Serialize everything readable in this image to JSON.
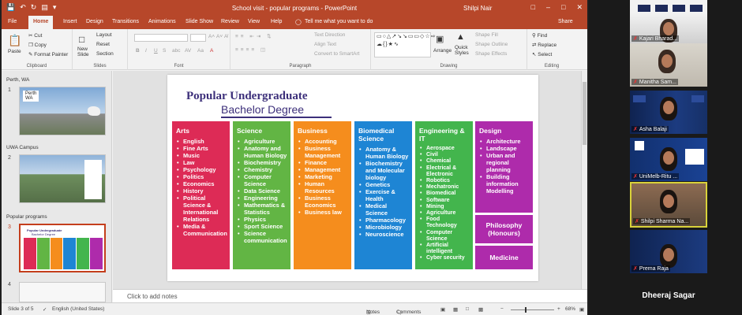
{
  "window": {
    "title": "School visit - popular programs  -  PowerPoint",
    "user": "Shilpi Nair",
    "qat_icons": [
      "save-icon",
      "undo-icon",
      "redo-icon",
      "present-icon"
    ],
    "controls": [
      "–",
      "□",
      "✕"
    ],
    "accent": "#b7472a"
  },
  "tabs": [
    "File",
    "Home",
    "Insert",
    "Design",
    "Transitions",
    "Animations",
    "Slide Show",
    "Review",
    "View",
    "Help"
  ],
  "tell_me": "Tell me what you want to do",
  "share": "Share",
  "ribbon": {
    "clipboard": {
      "paste": "Paste",
      "cut": "Cut",
      "copy": "Copy",
      "format_painter": "Format Painter",
      "label": "Clipboard"
    },
    "slides": {
      "new_slide": "New\nSlide",
      "layout": "Layout",
      "reset": "Reset",
      "section": "Section",
      "label": "Slides"
    },
    "font": {
      "label": "Font",
      "size_up": "A˄",
      "size_down": "A˅",
      "clear": "A̸",
      "bold": "B",
      "italic": "I",
      "underline": "U",
      "strike": "S",
      "abc": "abc",
      "spacing": "AV",
      "case": "Aa",
      "highlight": "A"
    },
    "paragraph": {
      "text_direction": "Text Direction",
      "align_text": "Align Text",
      "smartart": "Convert to SmartArt",
      "label": "Paragraph"
    },
    "drawing": {
      "shapes": "▭○△↗↘↘▭▭◇☆⇨☁{}★∿",
      "arrange": "Arrange",
      "quick_styles": "Quick\nStyles",
      "fill": "Shape Fill",
      "outline": "Shape Outline",
      "effects": "Shape Effects",
      "label": "Drawing"
    },
    "editing": {
      "find": "Find",
      "replace": "Replace",
      "select": "Select",
      "label": "Editing"
    }
  },
  "thumbnails": {
    "sections": [
      {
        "name": "Perth, WA",
        "slide_num": "1",
        "label": "Perth\nWA"
      },
      {
        "name": "UWA Campus",
        "slide_num": "2"
      },
      {
        "name": "Popular programs",
        "slide_num": "3",
        "t1": "Popular Undergraduate",
        "t2": "Bachelor Degree"
      },
      {
        "name": "",
        "slide_num": "4"
      }
    ]
  },
  "slide": {
    "title_line1": "Popular Undergraduate",
    "title_line2": "Bachelor Degree",
    "title_color": "#3c2f7a",
    "columns": [
      {
        "id": "arts",
        "heading": "Arts",
        "color": "#dd2b56",
        "items": [
          "English",
          "Fine Arts",
          "Music",
          "Law",
          "Psychology",
          "Politics",
          "Economics",
          "History",
          "Political Science & International Relations",
          "Media & Communication"
        ]
      },
      {
        "id": "science",
        "heading": "Science",
        "color": "#62b544",
        "items": [
          "Agriculture",
          "Anatomy and Human Biology",
          "Biochemistry",
          "Chemistry",
          "Computer Science",
          "Data Science",
          "Engineering",
          "Mathematics & Statistics",
          "Physics",
          "Sport Science",
          "Science communication"
        ]
      },
      {
        "id": "business",
        "heading": "Business",
        "color": "#f58d1d",
        "items": [
          "Accounting",
          "Business Management",
          "Finance",
          "Management",
          "Marketing",
          "Human Resources",
          "Business Economics",
          "Business law"
        ]
      },
      {
        "id": "biomed",
        "heading": "Biomedical Science",
        "color": "#1e85d4",
        "items": [
          "Anatomy & Human Biology",
          "Biochemistry and Molecular biology",
          "Genetics",
          "Exercise & Health",
          "Medical Science",
          "Pharmacology",
          "Microbiology",
          "Neuroscience"
        ]
      },
      {
        "id": "eng",
        "heading": "Engineering & IT",
        "color": "#43b54d",
        "items": [
          "Aerospace",
          "Civil",
          "Chemical",
          "Electrical & Electronic",
          "Robotics",
          "Mechatronic",
          "Biomedical",
          "Software",
          "Mining",
          "Agriculture",
          "Food Technology",
          "Computer Science",
          "Artificial intelligent",
          "Cyber security"
        ]
      },
      {
        "id": "design",
        "heading": "Design",
        "color": "#ae2bab",
        "items": [
          "Architecture",
          "Landscape",
          "Urban and regional planning",
          "Building information Modelling"
        ]
      }
    ],
    "extra_boxes": [
      {
        "id": "phil",
        "label": "Philosophy (Honours)"
      },
      {
        "id": "med",
        "label": "Medicine"
      }
    ]
  },
  "notes_placeholder": "Click to add notes",
  "status": {
    "slide": "Slide 3 of 5",
    "language": "English (United States)",
    "notes": "Notes",
    "comments": "Comments",
    "zoom": "68%",
    "zoom_value": 68
  },
  "participants": [
    {
      "name": "Kajari Bharad...",
      "muted": true
    },
    {
      "name": "Manitha Sam...",
      "muted": true
    },
    {
      "name": "Asha Balaji",
      "muted": true
    },
    {
      "name": "UniMelb-Ritu ...",
      "muted": true
    },
    {
      "name": "Shilpi Sharma Na...",
      "muted": true,
      "active": true
    },
    {
      "name": "Prema Raja",
      "muted": true
    },
    {
      "name": "Dheeraj Sagar",
      "video": false
    }
  ]
}
